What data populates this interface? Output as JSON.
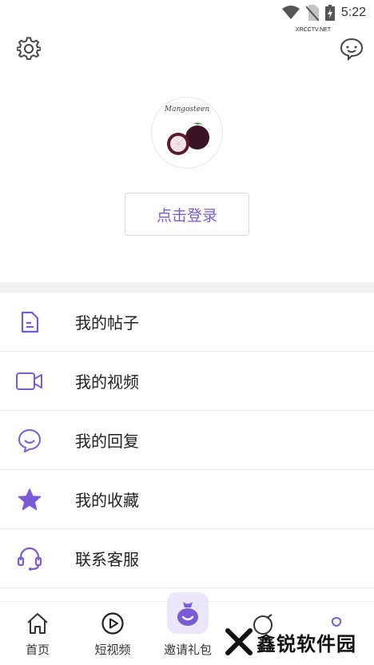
{
  "status_bar": {
    "time": "5:22",
    "icons": [
      "wifi-icon",
      "no-sim-icon",
      "battery-charging-icon"
    ]
  },
  "header": {
    "settings_icon": "gear-icon",
    "messages_icon": "chat-bubble-icon"
  },
  "profile": {
    "avatar_text": "Mangosteen",
    "login_label": "点击登录"
  },
  "menu": {
    "items": [
      {
        "label": "我的帖子",
        "icon": "document-icon"
      },
      {
        "label": "我的视频",
        "icon": "video-camera-icon"
      },
      {
        "label": "我的回复",
        "icon": "smile-chat-icon"
      },
      {
        "label": "我的收藏",
        "icon": "star-icon"
      },
      {
        "label": "联系客服",
        "icon": "headset-icon"
      }
    ]
  },
  "tabbar": {
    "tabs": [
      {
        "label": "首页",
        "icon": "home-icon"
      },
      {
        "label": "短视频",
        "icon": "play-circle-icon"
      },
      {
        "label": "邀请礼包",
        "icon": "gift-bag-icon"
      },
      {
        "label": "",
        "icon": "discover-icon"
      },
      {
        "label": "",
        "icon": "user-icon"
      }
    ]
  },
  "watermark": {
    "text": "鑫锐软件园",
    "sub": "XRCCTV.NET"
  },
  "colors": {
    "accent": "#7a5ad6",
    "divider": "#f2f2f2"
  }
}
